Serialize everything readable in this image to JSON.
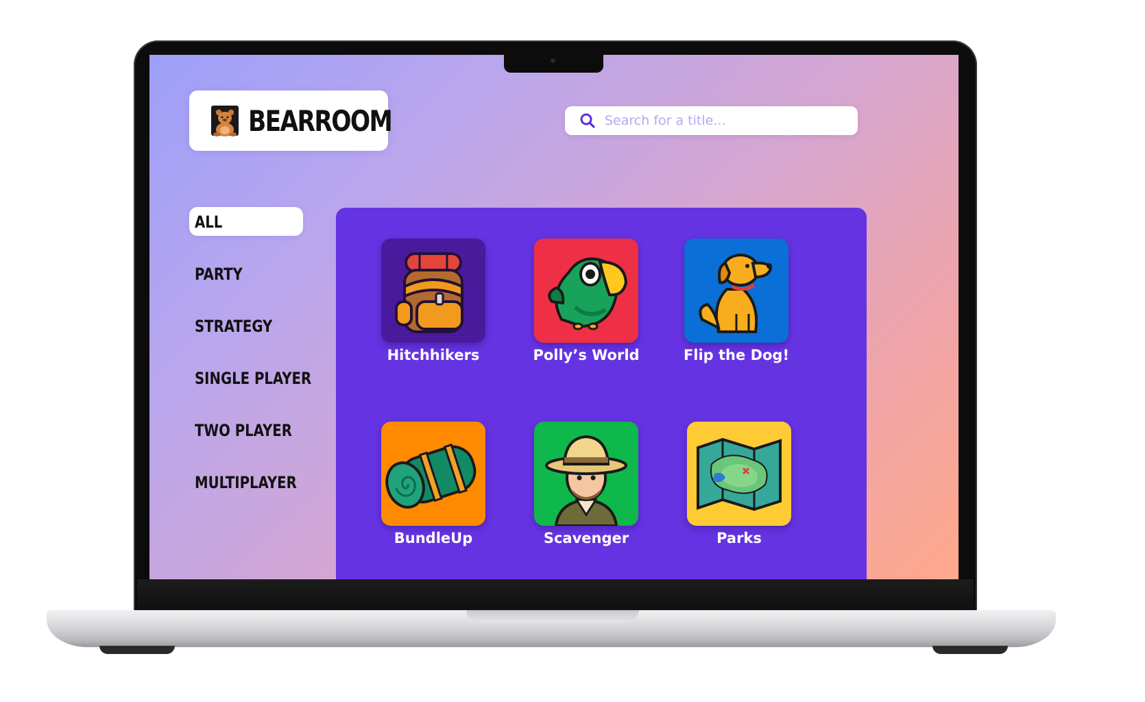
{
  "app": {
    "brand": "BEARROOM"
  },
  "search": {
    "placeholder": "Search for a title..."
  },
  "categories": [
    {
      "label": "ALL",
      "active": true
    },
    {
      "label": "PARTY",
      "active": false
    },
    {
      "label": "STRATEGY",
      "active": false
    },
    {
      "label": "SINGLE PLAYER",
      "active": false
    },
    {
      "label": "TWO PLAYER",
      "active": false
    },
    {
      "label": "MULTIPLAYER",
      "active": false
    }
  ],
  "games": [
    {
      "title": "Hitchhikers",
      "icon": "backpack-icon",
      "bg": "#4a1a9c"
    },
    {
      "title": "Polly’s World",
      "icon": "parrot-icon",
      "bg": "#ef2f45"
    },
    {
      "title": "Flip the Dog!",
      "icon": "dog-icon",
      "bg": "#0a6fd6"
    },
    {
      "title": "BundleUp",
      "icon": "sleeping-bag-icon",
      "bg": "#ff8a00"
    },
    {
      "title": "Scavenger",
      "icon": "explorer-icon",
      "bg": "#0fb84a"
    },
    {
      "title": "Parks",
      "icon": "map-icon",
      "bg": "#ffcb35"
    }
  ],
  "colors": {
    "panel": "#6633e3",
    "accent": "#5b2de0"
  }
}
